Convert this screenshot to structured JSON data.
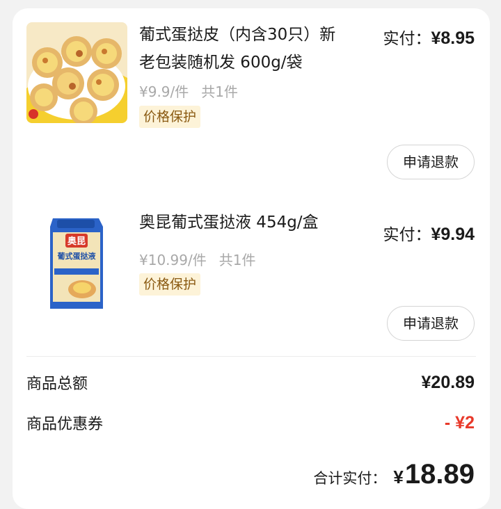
{
  "items": [
    {
      "image": "egg-tart-shells-photo",
      "title": "葡式蛋挞皮（内含30只）新老包装随机发 600g/袋",
      "paid_label": "实付：",
      "paid_amount": "¥8.95",
      "unit_price": "¥9.9/件",
      "quantity": "共1件",
      "badge": "价格保护",
      "refund_label": "申请退款"
    },
    {
      "image": "egg-tart-liquid-package-photo",
      "package_brand": "奥昆",
      "package_name": "葡式蛋挞液",
      "title": "奥昆葡式蛋挞液 454g/盒",
      "paid_label": "实付：",
      "paid_amount": "¥9.94",
      "unit_price": "¥10.99/件",
      "quantity": "共1件",
      "badge": "价格保护",
      "refund_label": "申请退款"
    }
  ],
  "summary": {
    "goods_total_label": "商品总额",
    "goods_total_value": "¥20.89",
    "coupon_label": "商品优惠券",
    "coupon_value": "- ¥2",
    "grand_label": "合计实付：",
    "grand_symbol": "¥",
    "grand_value": "18.89"
  },
  "colors": {
    "discount_red": "#e8392a",
    "badge_bg": "#fdf3d8",
    "badge_text": "#8a5a12",
    "muted_text": "#a8a8a8"
  }
}
